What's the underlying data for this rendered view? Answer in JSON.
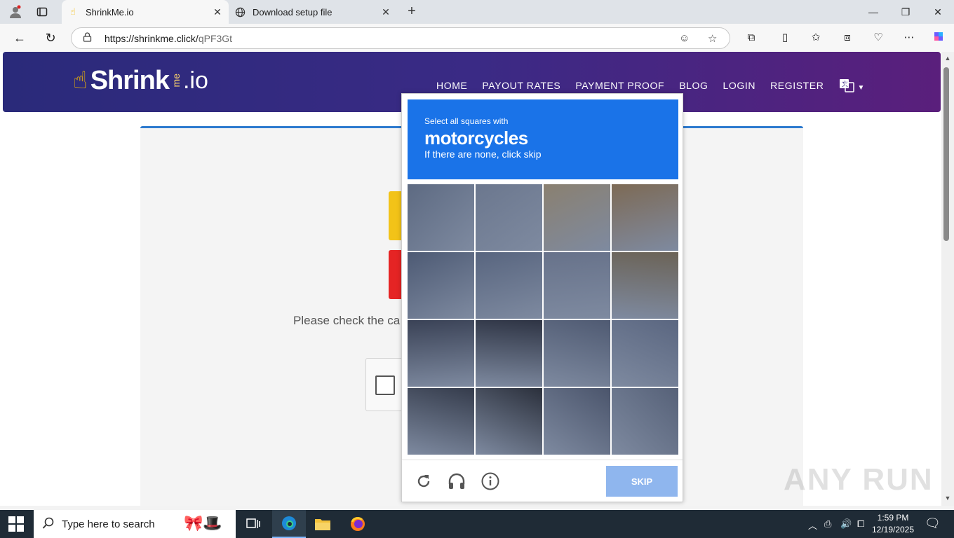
{
  "browser": {
    "tabs": [
      {
        "title": "ShrinkMe.io",
        "active": true
      },
      {
        "title": "Download setup file",
        "active": false
      }
    ],
    "url_host": "https://shrinkme.click/",
    "url_path": "qPF3Gt"
  },
  "site": {
    "logo": {
      "brand": "Shrink",
      "me": "me",
      "tld": ".io"
    },
    "nav": [
      "HOME",
      "PAYOUT RATES",
      "PAYMENT PROOF",
      "BLOG",
      "LOGIN",
      "REGISTER"
    ],
    "check_text": "Please check the ca"
  },
  "captcha": {
    "instruction_line1": "Select all squares with",
    "target": "motorcycles",
    "instruction_line3": "If there are none, click skip",
    "skip_label": "SKIP",
    "grid_size": 4,
    "accent_color": "#1a73e8"
  },
  "watermark": "ANY RUN",
  "taskbar": {
    "search_placeholder": "Type here to search",
    "time": "1:59 PM",
    "date": "12/19/2025"
  }
}
